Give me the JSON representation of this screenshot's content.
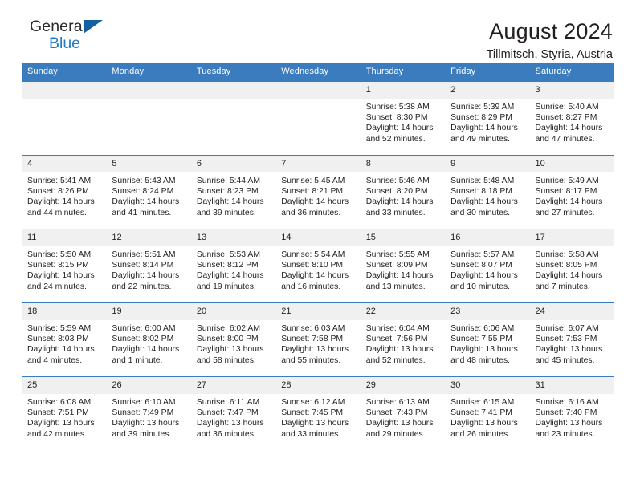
{
  "brand": {
    "name_top": "General",
    "name_bottom": "Blue",
    "triangle_color": "#15619f",
    "blue_text_color": "#1f7dc4"
  },
  "header": {
    "title": "August 2024",
    "subtitle": "Tillmitsch, Styria, Austria"
  },
  "theme": {
    "header_bg": "#3a7cbe",
    "daynum_bg": "#f0f0f0",
    "row_border": "#3a7cbe",
    "text": "#231f20"
  },
  "calendar": {
    "weekday_headers": [
      "Sunday",
      "Monday",
      "Tuesday",
      "Wednesday",
      "Thursday",
      "Friday",
      "Saturday"
    ],
    "weeks": [
      [
        {
          "day": "",
          "lines": []
        },
        {
          "day": "",
          "lines": []
        },
        {
          "day": "",
          "lines": []
        },
        {
          "day": "",
          "lines": []
        },
        {
          "day": "1",
          "lines": [
            "Sunrise: 5:38 AM",
            "Sunset: 8:30 PM",
            "Daylight: 14 hours",
            "and 52 minutes."
          ]
        },
        {
          "day": "2",
          "lines": [
            "Sunrise: 5:39 AM",
            "Sunset: 8:29 PM",
            "Daylight: 14 hours",
            "and 49 minutes."
          ]
        },
        {
          "day": "3",
          "lines": [
            "Sunrise: 5:40 AM",
            "Sunset: 8:27 PM",
            "Daylight: 14 hours",
            "and 47 minutes."
          ]
        }
      ],
      [
        {
          "day": "4",
          "lines": [
            "Sunrise: 5:41 AM",
            "Sunset: 8:26 PM",
            "Daylight: 14 hours",
            "and 44 minutes."
          ]
        },
        {
          "day": "5",
          "lines": [
            "Sunrise: 5:43 AM",
            "Sunset: 8:24 PM",
            "Daylight: 14 hours",
            "and 41 minutes."
          ]
        },
        {
          "day": "6",
          "lines": [
            "Sunrise: 5:44 AM",
            "Sunset: 8:23 PM",
            "Daylight: 14 hours",
            "and 39 minutes."
          ]
        },
        {
          "day": "7",
          "lines": [
            "Sunrise: 5:45 AM",
            "Sunset: 8:21 PM",
            "Daylight: 14 hours",
            "and 36 minutes."
          ]
        },
        {
          "day": "8",
          "lines": [
            "Sunrise: 5:46 AM",
            "Sunset: 8:20 PM",
            "Daylight: 14 hours",
            "and 33 minutes."
          ]
        },
        {
          "day": "9",
          "lines": [
            "Sunrise: 5:48 AM",
            "Sunset: 8:18 PM",
            "Daylight: 14 hours",
            "and 30 minutes."
          ]
        },
        {
          "day": "10",
          "lines": [
            "Sunrise: 5:49 AM",
            "Sunset: 8:17 PM",
            "Daylight: 14 hours",
            "and 27 minutes."
          ]
        }
      ],
      [
        {
          "day": "11",
          "lines": [
            "Sunrise: 5:50 AM",
            "Sunset: 8:15 PM",
            "Daylight: 14 hours",
            "and 24 minutes."
          ]
        },
        {
          "day": "12",
          "lines": [
            "Sunrise: 5:51 AM",
            "Sunset: 8:14 PM",
            "Daylight: 14 hours",
            "and 22 minutes."
          ]
        },
        {
          "day": "13",
          "lines": [
            "Sunrise: 5:53 AM",
            "Sunset: 8:12 PM",
            "Daylight: 14 hours",
            "and 19 minutes."
          ]
        },
        {
          "day": "14",
          "lines": [
            "Sunrise: 5:54 AM",
            "Sunset: 8:10 PM",
            "Daylight: 14 hours",
            "and 16 minutes."
          ]
        },
        {
          "day": "15",
          "lines": [
            "Sunrise: 5:55 AM",
            "Sunset: 8:09 PM",
            "Daylight: 14 hours",
            "and 13 minutes."
          ]
        },
        {
          "day": "16",
          "lines": [
            "Sunrise: 5:57 AM",
            "Sunset: 8:07 PM",
            "Daylight: 14 hours",
            "and 10 minutes."
          ]
        },
        {
          "day": "17",
          "lines": [
            "Sunrise: 5:58 AM",
            "Sunset: 8:05 PM",
            "Daylight: 14 hours",
            "and 7 minutes."
          ]
        }
      ],
      [
        {
          "day": "18",
          "lines": [
            "Sunrise: 5:59 AM",
            "Sunset: 8:03 PM",
            "Daylight: 14 hours",
            "and 4 minutes."
          ]
        },
        {
          "day": "19",
          "lines": [
            "Sunrise: 6:00 AM",
            "Sunset: 8:02 PM",
            "Daylight: 14 hours",
            "and 1 minute."
          ]
        },
        {
          "day": "20",
          "lines": [
            "Sunrise: 6:02 AM",
            "Sunset: 8:00 PM",
            "Daylight: 13 hours",
            "and 58 minutes."
          ]
        },
        {
          "day": "21",
          "lines": [
            "Sunrise: 6:03 AM",
            "Sunset: 7:58 PM",
            "Daylight: 13 hours",
            "and 55 minutes."
          ]
        },
        {
          "day": "22",
          "lines": [
            "Sunrise: 6:04 AM",
            "Sunset: 7:56 PM",
            "Daylight: 13 hours",
            "and 52 minutes."
          ]
        },
        {
          "day": "23",
          "lines": [
            "Sunrise: 6:06 AM",
            "Sunset: 7:55 PM",
            "Daylight: 13 hours",
            "and 48 minutes."
          ]
        },
        {
          "day": "24",
          "lines": [
            "Sunrise: 6:07 AM",
            "Sunset: 7:53 PM",
            "Daylight: 13 hours",
            "and 45 minutes."
          ]
        }
      ],
      [
        {
          "day": "25",
          "lines": [
            "Sunrise: 6:08 AM",
            "Sunset: 7:51 PM",
            "Daylight: 13 hours",
            "and 42 minutes."
          ]
        },
        {
          "day": "26",
          "lines": [
            "Sunrise: 6:10 AM",
            "Sunset: 7:49 PM",
            "Daylight: 13 hours",
            "and 39 minutes."
          ]
        },
        {
          "day": "27",
          "lines": [
            "Sunrise: 6:11 AM",
            "Sunset: 7:47 PM",
            "Daylight: 13 hours",
            "and 36 minutes."
          ]
        },
        {
          "day": "28",
          "lines": [
            "Sunrise: 6:12 AM",
            "Sunset: 7:45 PM",
            "Daylight: 13 hours",
            "and 33 minutes."
          ]
        },
        {
          "day": "29",
          "lines": [
            "Sunrise: 6:13 AM",
            "Sunset: 7:43 PM",
            "Daylight: 13 hours",
            "and 29 minutes."
          ]
        },
        {
          "day": "30",
          "lines": [
            "Sunrise: 6:15 AM",
            "Sunset: 7:41 PM",
            "Daylight: 13 hours",
            "and 26 minutes."
          ]
        },
        {
          "day": "31",
          "lines": [
            "Sunrise: 6:16 AM",
            "Sunset: 7:40 PM",
            "Daylight: 13 hours",
            "and 23 minutes."
          ]
        }
      ]
    ]
  }
}
